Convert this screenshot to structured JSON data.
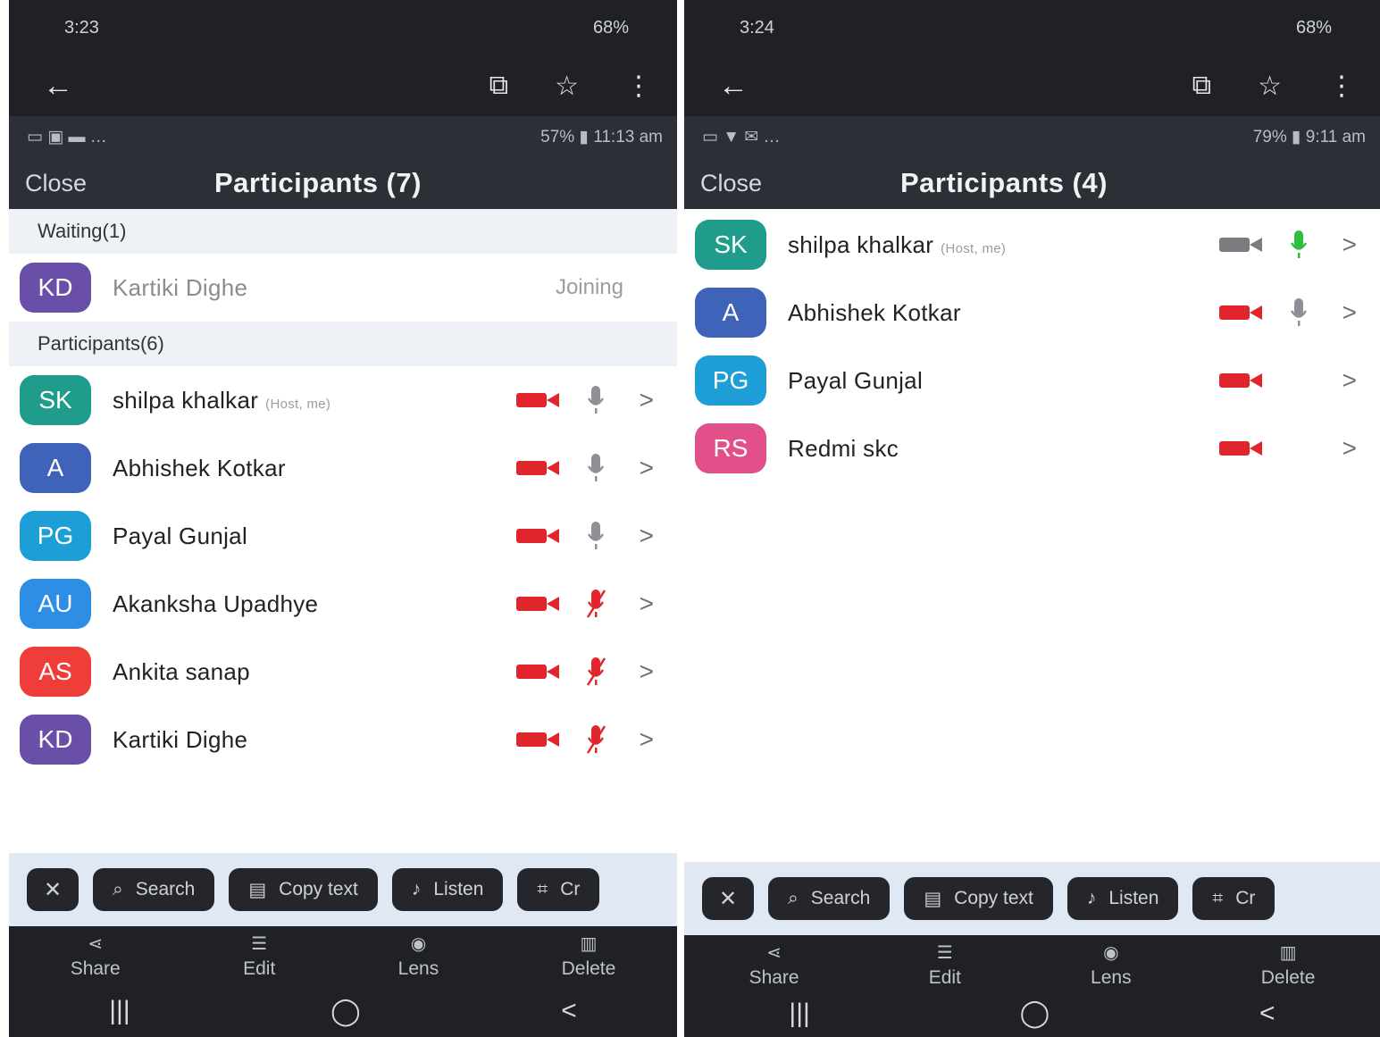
{
  "colors": {
    "camera_off": "#e0262c",
    "camera_on": "#7a7c80",
    "mic_on": "#2fbf3f",
    "mic_idle": "#8e9095",
    "mic_muted": "#e0262c",
    "avatar_purple": "#6a4fa8",
    "avatar_teal": "#1f9c8c",
    "avatar_indigo": "#3f63b8",
    "avatar_cyan": "#1e9ed6",
    "avatar_azure": "#2e8ee6",
    "avatar_red": "#ef3e3a",
    "avatar_pink": "#e2508a"
  },
  "left": {
    "status": {
      "time": "3:23",
      "battery": "68%"
    },
    "zoom_status": {
      "battery": "57%",
      "time": "11:13 am"
    },
    "close": "Close",
    "title": "Participants (7)",
    "waiting_label": "Waiting(1)",
    "waiting": [
      {
        "initials": "KD",
        "name": "Kartiki Dighe",
        "status": "Joining",
        "color": "avatar_purple"
      }
    ],
    "participants_label": "Participants(6)",
    "participants": [
      {
        "initials": "SK",
        "name": "shilpa khalkar",
        "tag": "(Host, me)",
        "color": "avatar_teal",
        "video": "off",
        "mic": "idle"
      },
      {
        "initials": "A",
        "name": "Abhishek  Kotkar",
        "color": "avatar_indigo",
        "video": "off",
        "mic": "idle"
      },
      {
        "initials": "PG",
        "name": "Payal Gunjal",
        "color": "avatar_cyan",
        "video": "off",
        "mic": "idle"
      },
      {
        "initials": "AU",
        "name": "Akanksha Upadhye",
        "color": "avatar_azure",
        "video": "off",
        "mic": "muted"
      },
      {
        "initials": "AS",
        "name": "Ankita sanap",
        "color": "avatar_red",
        "video": "off",
        "mic": "muted"
      },
      {
        "initials": "KD",
        "name": "Kartiki Dighe",
        "color": "avatar_purple",
        "video": "off",
        "mic": "muted"
      }
    ]
  },
  "right": {
    "status": {
      "time": "3:24",
      "battery": "68%"
    },
    "zoom_status": {
      "battery": "79%",
      "time": "9:11 am"
    },
    "close": "Close",
    "title": "Participants (4)",
    "participants": [
      {
        "initials": "SK",
        "name": "shilpa khalkar",
        "tag": "(Host, me)",
        "color": "avatar_teal",
        "video": "on",
        "mic": "on"
      },
      {
        "initials": "A",
        "name": "Abhishek  Kotkar",
        "color": "avatar_indigo",
        "video": "off",
        "mic": "idle"
      },
      {
        "initials": "PG",
        "name": "Payal Gunjal",
        "color": "avatar_cyan",
        "video": "off",
        "mic": "none"
      },
      {
        "initials": "RS",
        "name": "Redmi skc",
        "color": "avatar_pink",
        "video": "off",
        "mic": "none"
      }
    ]
  },
  "lens": {
    "close": "✕",
    "search": "Search",
    "copy_text": "Copy text",
    "listen": "Listen",
    "crop": "Cr"
  },
  "actions": {
    "share": "Share",
    "edit": "Edit",
    "lens": "Lens",
    "delete": "Delete"
  },
  "nav": {
    "recents": "|||",
    "home": "◯",
    "back": "<"
  }
}
